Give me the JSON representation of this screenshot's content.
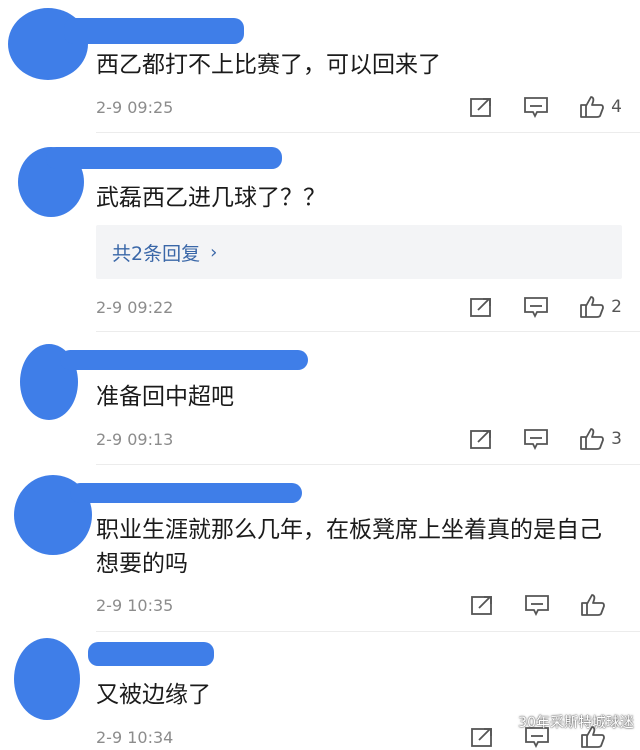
{
  "comments": [
    {
      "text": "西乙都打不上比赛了，可以回来了",
      "time": "2-9 09:25",
      "likes": "4"
    },
    {
      "text": "武磊西乙进几球了？？",
      "time": "2-9 09:22",
      "likes": "2",
      "reply_label": "共2条回复",
      "reply_chevron": "›"
    },
    {
      "text": "准备回中超吧",
      "time": "2-9 09:13",
      "likes": "3"
    },
    {
      "text": "职业生涯就那么几年，在板凳席上坐着真的是自己想要的吗",
      "time": "2-9 10:35",
      "likes": ""
    },
    {
      "text": "又被边缘了",
      "time": "2-9 10:34",
      "likes": ""
    }
  ],
  "watermark": "30年采斯特城球迷",
  "colors": {
    "redaction": "#3f7ee8",
    "reply_link": "#3a67a8",
    "meta_gray": "#8c8c8c"
  }
}
